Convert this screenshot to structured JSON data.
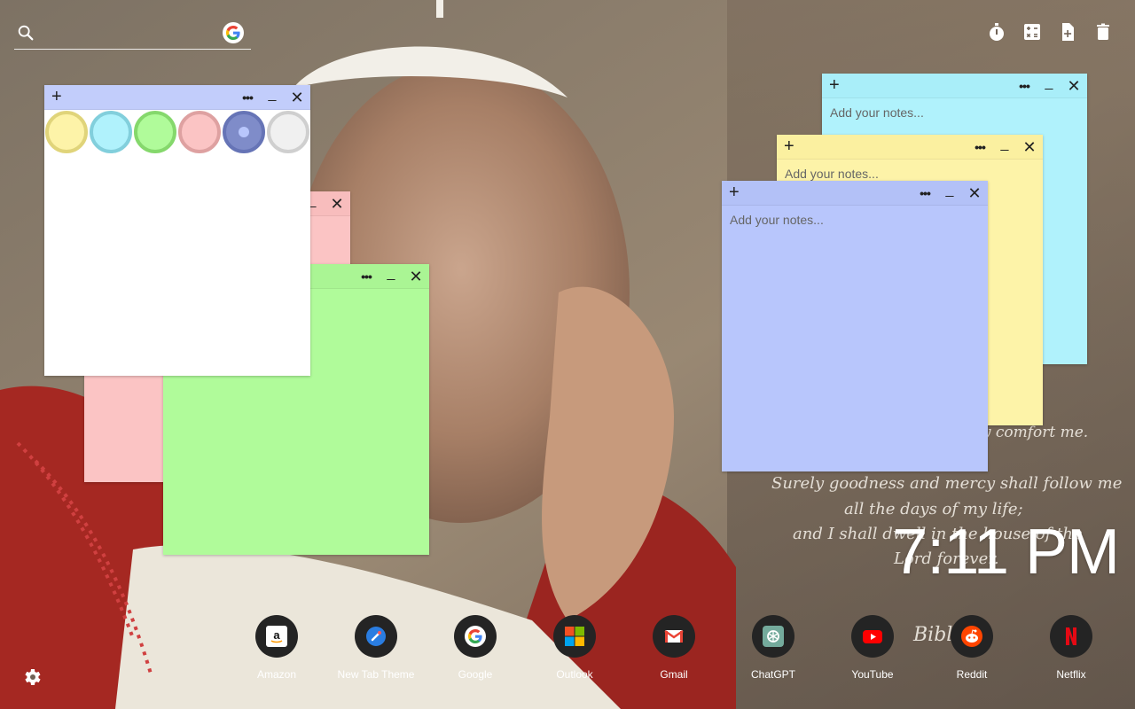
{
  "search": {
    "placeholder": "",
    "engine_icon": "google-icon"
  },
  "toolbar": {
    "icons": [
      "timer-icon",
      "calculator-icon",
      "add-note-icon",
      "trash-icon"
    ]
  },
  "notes": [
    {
      "id": "cyan-note",
      "color": "#b0f2fc",
      "bar_color": "#a9eef9",
      "placeholder": "Add your notes...",
      "text": ""
    },
    {
      "id": "yellow-note",
      "color": "#fdf3a8",
      "bar_color": "#fbf0a0",
      "placeholder": "Add your notes...",
      "text": ""
    },
    {
      "id": "blue-note",
      "color": "#b8c6fc",
      "bar_color": "#b3c1f7",
      "placeholder": "Add your notes...",
      "text": ""
    },
    {
      "id": "pink-note",
      "color": "#fbc4c4",
      "bar_color": "#f8bdbd",
      "placeholder": "",
      "text": ""
    },
    {
      "id": "green-note",
      "color": "#b0fb9a",
      "bar_color": "#aaf594",
      "placeholder": "",
      "text": ""
    },
    {
      "id": "white-note",
      "color": "#ffffff",
      "bar_color": "#c2cdfb",
      "placeholder": "",
      "text": ""
    }
  ],
  "palette": [
    {
      "name": "yellow",
      "fill": "#fdf3a8",
      "ring": "#e0d47a"
    },
    {
      "name": "cyan",
      "fill": "#b0f2fc",
      "ring": "#82cfdc"
    },
    {
      "name": "green",
      "fill": "#b0fb9a",
      "ring": "#85d86c"
    },
    {
      "name": "pink",
      "fill": "#fbc4c4",
      "ring": "#dea1a1"
    },
    {
      "name": "blue",
      "fill": "#7f8cc9",
      "ring": "#6674b6",
      "selected": true
    },
    {
      "name": "white",
      "fill": "#f0f0f0",
      "ring": "#cfcfcf"
    }
  ],
  "clock": {
    "time": "7:11 PM"
  },
  "verse": [
    "they comfort me.",
    "Surely goodness and mercy shall follow me",
    "all the days of my life;",
    "and I shall dwell in the house of the",
    "Lord forever.",
    "Bible"
  ],
  "shortcuts": [
    {
      "label": "Amazon",
      "icon": "amazon-icon"
    },
    {
      "label": "New Tab Theme",
      "icon": "new-tab-theme-icon"
    },
    {
      "label": "Google",
      "icon": "google-icon"
    },
    {
      "label": "Outlook",
      "icon": "outlook-icon"
    },
    {
      "label": "Gmail",
      "icon": "gmail-icon"
    },
    {
      "label": "ChatGPT",
      "icon": "chatgpt-icon"
    },
    {
      "label": "YouTube",
      "icon": "youtube-icon"
    },
    {
      "label": "Reddit",
      "icon": "reddit-icon"
    },
    {
      "label": "Netflix",
      "icon": "netflix-icon"
    }
  ],
  "settings": {
    "icon": "gear-icon"
  }
}
